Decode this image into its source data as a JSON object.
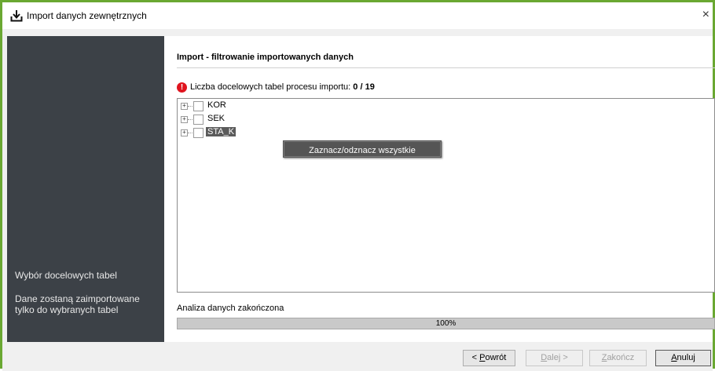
{
  "window": {
    "title": "Import danych zewnętrznych",
    "close_glyph": "×",
    "accent_color": "#6aa832"
  },
  "sidebar": {
    "step_title": "Wybór docelowych tabel",
    "step_description": "Dane zostaną zaimportowane tylko do wybranych tabel"
  },
  "main": {
    "heading": "Import - filtrowanie importowanych danych",
    "warning_icon": "exclamation-icon",
    "count_label": "Liczba docelowych tabel procesu importu:",
    "count_value": "0 / 19",
    "tree": [
      {
        "label": "KOR",
        "checked": false,
        "selected": false
      },
      {
        "label": "SEK",
        "checked": false,
        "selected": false
      },
      {
        "label": "STA_K",
        "checked": false,
        "selected": true
      }
    ],
    "context_menu": {
      "item": "Zaznacz/odznacz wszystkie"
    },
    "status": "Analiza danych zakończona",
    "progress": {
      "percent": 100,
      "label": "100%"
    }
  },
  "footer": {
    "back_prefix": "< ",
    "back_key": "P",
    "back_rest": "owrót",
    "next_key": "D",
    "next_rest": "alej >",
    "finish_key": "Z",
    "finish_rest": "akończ",
    "cancel_key": "A",
    "cancel_rest": "nuluj"
  }
}
